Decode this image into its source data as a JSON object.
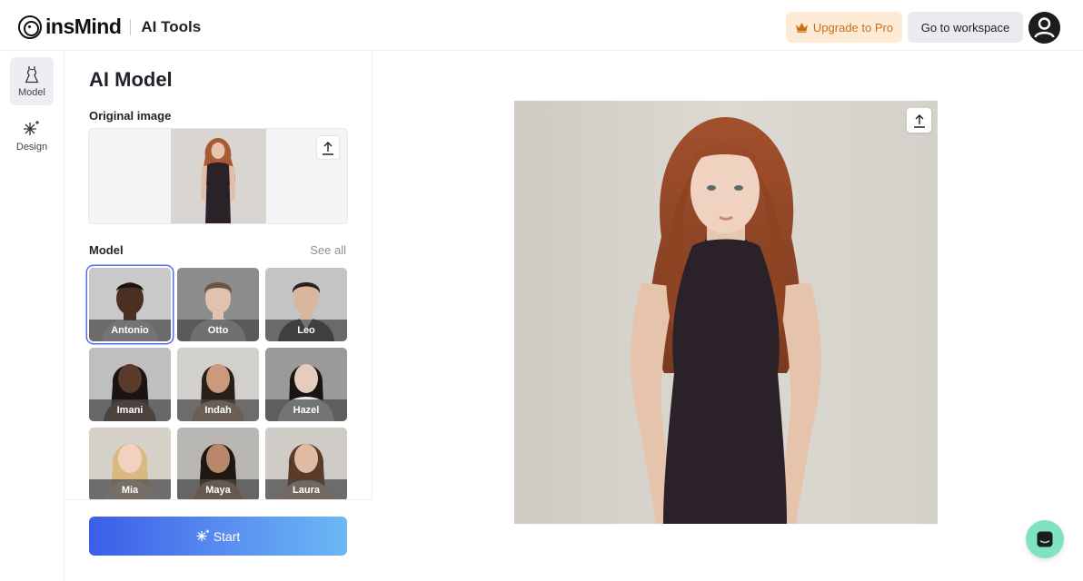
{
  "header": {
    "brand": "insMind",
    "section": "AI Tools",
    "upgrade_label": "Upgrade to Pro",
    "workspace_label": "Go to workspace",
    "colors": {
      "upgrade_bg": "#fdebd6",
      "upgrade_text": "#c9701d"
    }
  },
  "rail": {
    "items": [
      {
        "label": "Model",
        "icon": "dress-icon",
        "active": true
      },
      {
        "label": "Design",
        "icon": "sparkle-icon",
        "active": false
      }
    ]
  },
  "panel": {
    "title": "AI Model",
    "original_image_label": "Original image",
    "model_label": "Model",
    "see_all_label": "See all",
    "models": [
      {
        "name": "Antonio",
        "selected": true
      },
      {
        "name": "Otto",
        "selected": false
      },
      {
        "name": "Leo",
        "selected": false
      },
      {
        "name": "Imani",
        "selected": false
      },
      {
        "name": "Indah",
        "selected": false
      },
      {
        "name": "Hazel",
        "selected": false
      },
      {
        "name": "Mia",
        "selected": false
      },
      {
        "name": "Maya",
        "selected": false
      },
      {
        "name": "Laura",
        "selected": false
      }
    ],
    "start_label": "Start",
    "accent": "#4d6ef5"
  }
}
